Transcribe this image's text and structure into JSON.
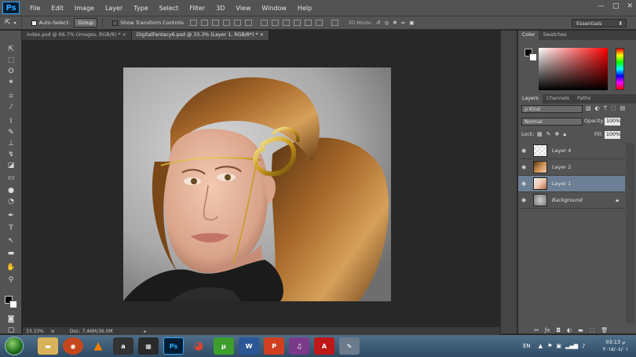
{
  "app": {
    "logo": "Ps"
  },
  "menu": {
    "items": [
      "File",
      "Edit",
      "Image",
      "Layer",
      "Type",
      "Select",
      "Filter",
      "3D",
      "View",
      "Window",
      "Help"
    ]
  },
  "window_controls": {
    "minimize": "—",
    "maximize": "□",
    "close": "✕"
  },
  "options": {
    "auto_select_label": "Auto-Select:",
    "auto_select_value": "Group",
    "transform_label": "Show Transform Controls",
    "mode_3d": "3D Mode:",
    "workspace": "Essentials"
  },
  "tabs": [
    {
      "label": "index.psd @ 66.7% (images, RGB/8) *",
      "close": "×"
    },
    {
      "label": "DigitalFantacy6.psd @ 33.3% (Layer 1, RGB/8*) *",
      "close": "×"
    }
  ],
  "status": {
    "zoom": "33.33%",
    "doc": "Doc: 7.46M/36.0M"
  },
  "color_panel": {
    "tabs": [
      "Color",
      "Swatches"
    ]
  },
  "layers_panel": {
    "tabs": [
      "Layers",
      "Channels",
      "Paths"
    ],
    "kind_label": "ρ Kind",
    "blend_mode": "Normal",
    "opacity_label": "Opacity:",
    "opacity_value": "100%",
    "lock_label": "Lock:",
    "fill_label": "Fill:",
    "fill_value": "100%",
    "layers": [
      {
        "name": "Layer 4",
        "selected": false
      },
      {
        "name": "Layer 2",
        "selected": false
      },
      {
        "name": "Layer 1",
        "selected": true
      },
      {
        "name": "Background",
        "selected": false
      }
    ]
  },
  "taskbar": {
    "language": "EN",
    "time": "03:13 م",
    "date": "٢٠١٥/٠٤/٠١"
  },
  "colors": {
    "accent_selected_layer": "#6d7f95",
    "panel": "#535353",
    "workspace": "#282828"
  }
}
